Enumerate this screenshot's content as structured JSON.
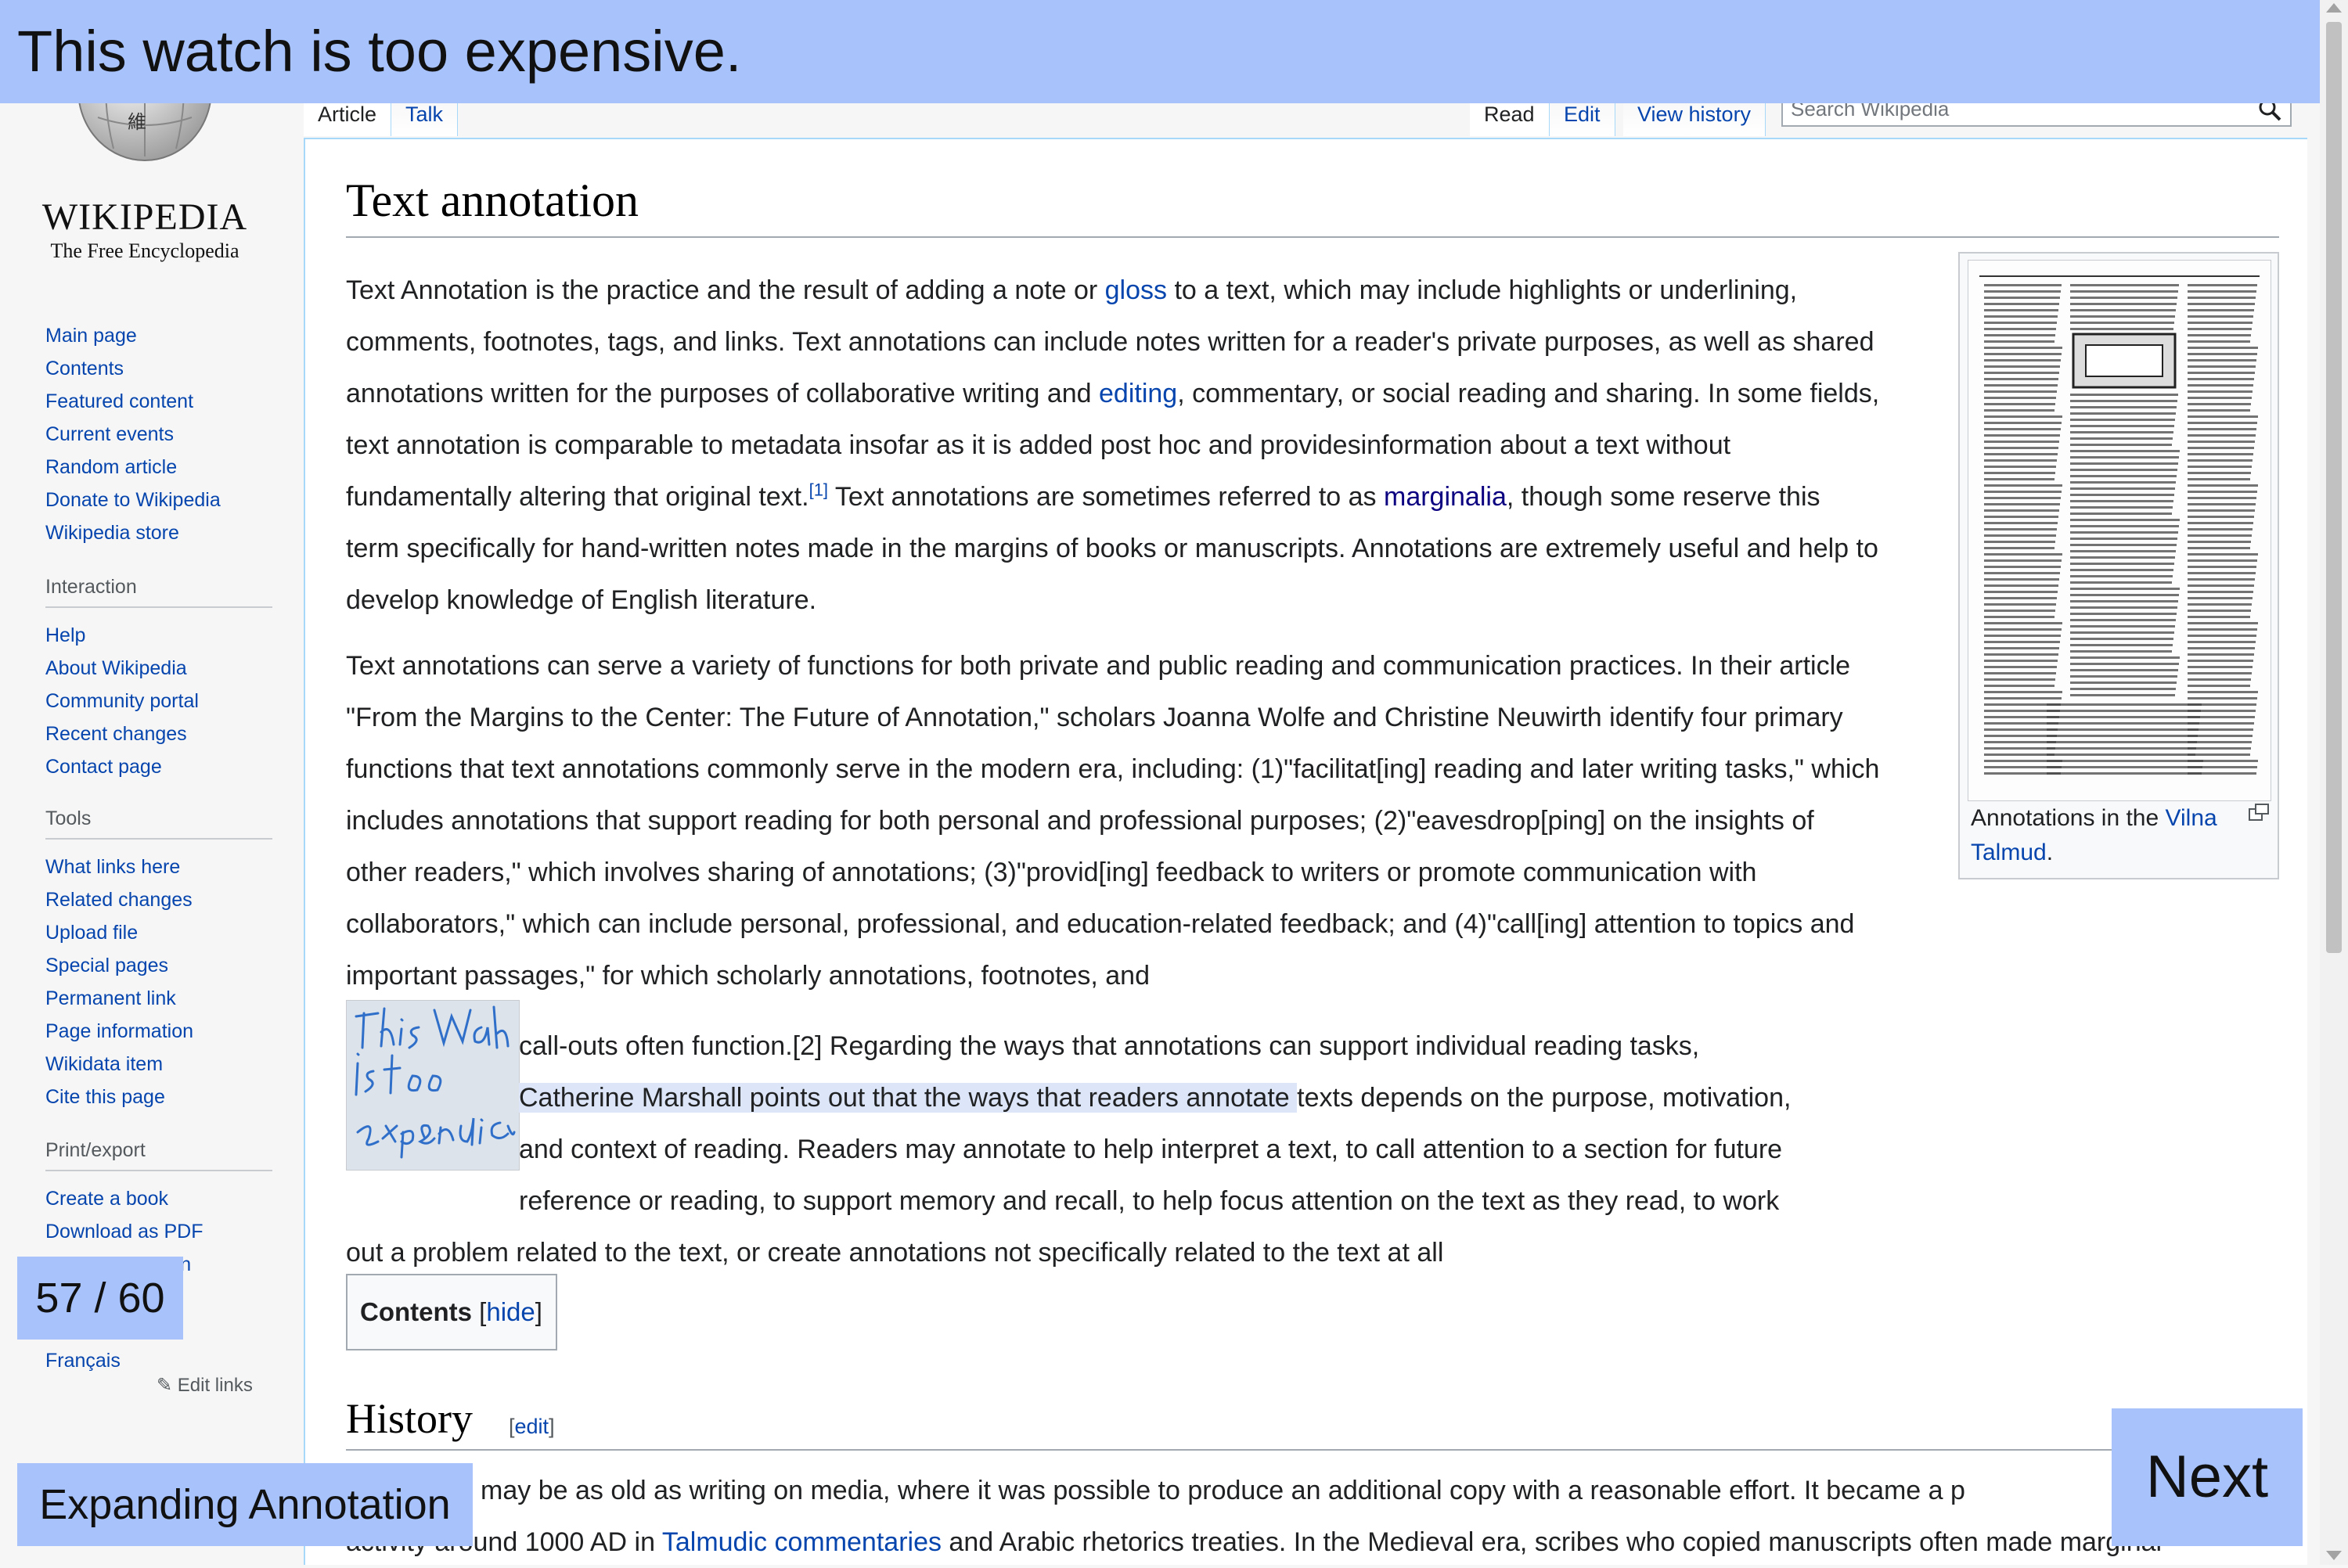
{
  "overlay": {
    "title": "This watch is too expensive.",
    "page_counter": "57 / 60",
    "mode_label": "Expanding Annotation",
    "next_label": "Next",
    "accent_color": "#a8c2fb"
  },
  "logo": {
    "wordmark": "WIKIPEDIA",
    "tagline": "The Free Encyclopedia"
  },
  "sidebar": {
    "main": [
      "Main page",
      "Contents",
      "Featured content",
      "Current events",
      "Random article",
      "Donate to Wikipedia",
      "Wikipedia store"
    ],
    "interaction_heading": "Interaction",
    "interaction": [
      "Help",
      "About Wikipedia",
      "Community portal",
      "Recent changes",
      "Contact page"
    ],
    "tools_heading": "Tools",
    "tools": [
      "What links here",
      "Related changes",
      "Upload file",
      "Special pages",
      "Permanent link",
      "Page information",
      "Wikidata item",
      "Cite this page"
    ],
    "print_heading": "Print/export",
    "print": [
      "Create a book",
      "Download as PDF",
      "Printable version"
    ],
    "languages": [
      "Français"
    ],
    "edit_links": "Edit links"
  },
  "tabs": {
    "article": "Article",
    "talk": "Talk",
    "read": "Read",
    "edit": "Edit",
    "view_history": "View history"
  },
  "search": {
    "placeholder": "Search Wikipedia"
  },
  "article": {
    "title": "Text annotation",
    "p1_a": "Text Annotation is the practice and the result of adding a note or ",
    "p1_gloss": "gloss",
    "p1_b": " to a text, which may include highlights or underlining, comments, footnotes, tags, and links. Text annotations can include notes written for a reader's private purposes, as well as shared annotations written for the purposes of collaborative writing and ",
    "p1_editing": "editing",
    "p1_c": ", commentary, or social reading and sharing. In some fields, text annotation is comparable to metadata insofar as it is added post hoc and providesinformation about a text without fundamentally altering that original text.",
    "p1_ref": "[1]",
    "p1_d": " Text annotations are sometimes referred to as ",
    "p1_marginalia": "marginalia",
    "p1_e": ", though some reserve this term specifically for hand-written notes made in the margins of books or manuscripts. Annotations are extremely useful and help to develop knowledge of English literature.",
    "p2": "Text annotations can serve a variety of functions for both private and public reading and communication practices. In their article \"From the Margins to the Center: The Future of Annotation,\" scholars Joanna Wolfe and Christine Neuwirth identify four primary functions that text annotations commonly serve in the modern era, including: (1)\"facilitat[ing] reading and later writing tasks,\" which includes annotations that support reading for both personal and professional purposes; (2)\"eavesdrop[ping] on the insights of other readers,\" which involves sharing of annotations; (3)\"provid[ing] feedback to writers or promote communication with collaborators,\" which can include personal, professional, and education-related feedback; and (4)\"call[ing] attention to topics and important passages,\" for which scholarly annotations, footnotes, and",
    "line_callouts": "call-outs often function.[2] Regarding the ways that annotations can support individual reading tasks,",
    "line_highlight": "Catherine Marshall points out that the ways that readers annotate ",
    "line_highlight_rest": "texts depends on the purpose, motivation,",
    "line_context": "and context of reading. Readers may annotate to help interpret a text, to call attention to a section for future",
    "line_reference": "reference or reading, to support memory and recall, to help focus attention on the text as they read, to work",
    "line_last": "out a problem related to the text, or create annotations not specifically related to the text at all",
    "note_handwriting": "This watch is too expensive",
    "thumb_caption_a": "Annotations in the ",
    "thumb_caption_link": "Vilna Talmud",
    "thumb_caption_b": ".",
    "toc_label": "Contents",
    "toc_hide": "hide",
    "history_heading": "History",
    "history_edit": "edit",
    "p4_line1_a": "Annotation may be as old as writing on media, where it was possible to produce an additional copy with a reasonable effort. It became a p",
    "p4_line2_a": "activity around 1000 AD in ",
    "p4_line2_link": "Talmudic commentaries",
    "p4_line2_b": " and Arabic rhetorics treaties. In the Medieval era, scribes who copied manuscripts often made marginal"
  }
}
